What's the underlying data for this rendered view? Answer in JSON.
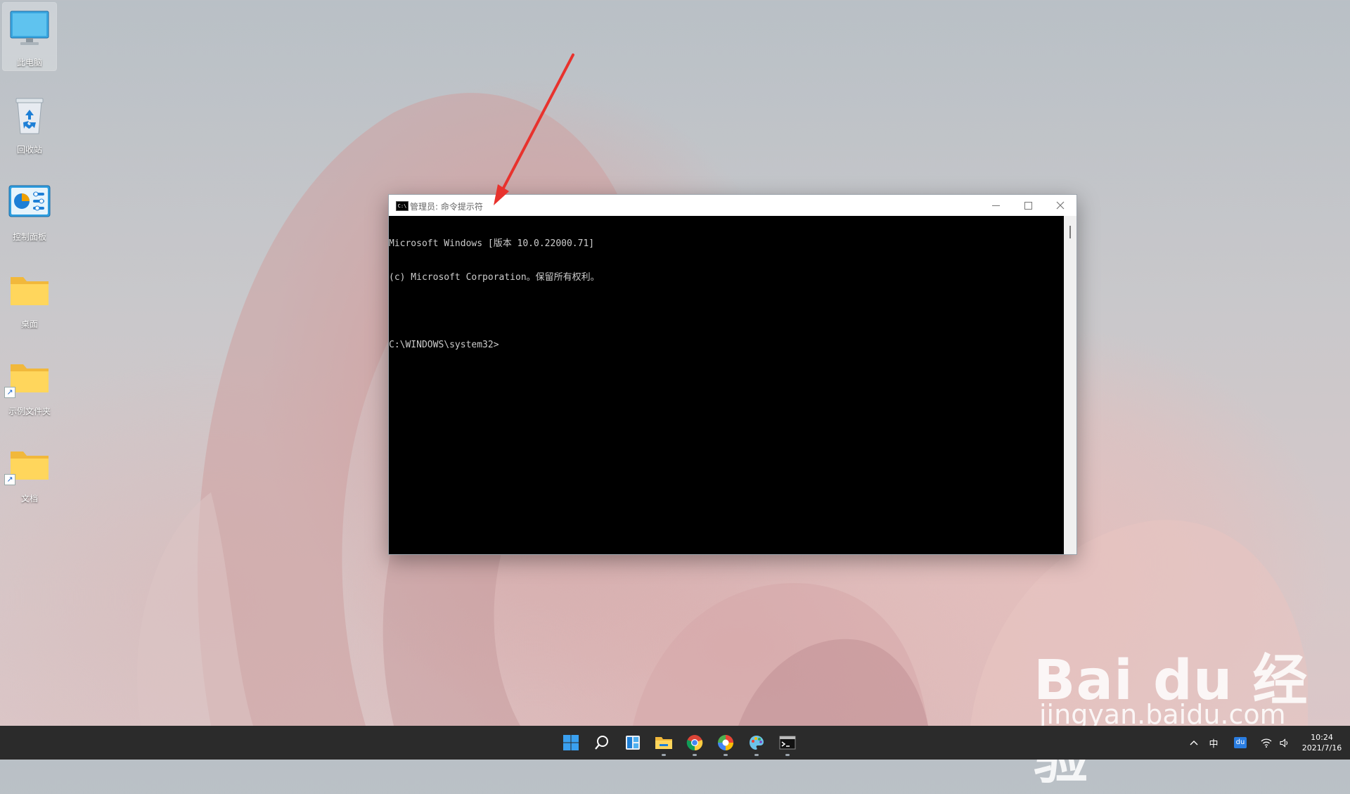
{
  "desktop": {
    "icons": [
      {
        "label": "此电脑"
      },
      {
        "label": "回收站"
      },
      {
        "label": "控制面板"
      },
      {
        "label": "桌面"
      },
      {
        "label": "示例文件夹"
      },
      {
        "label": "文档"
      }
    ]
  },
  "cmd_window": {
    "title": "管理员: 命令提示符",
    "icon_text": "C:\\",
    "lines": [
      "Microsoft Windows [版本 10.0.22000.71]",
      "(c) Microsoft Corporation。保留所有权利。",
      "",
      "C:\\WINDOWS\\system32>"
    ]
  },
  "taskbar": {
    "icons": [
      "windows-start-icon",
      "search-icon",
      "widgets-icon",
      "file-explorer-icon",
      "chrome-icon",
      "color-browser-icon",
      "paint-icon",
      "terminal-icon"
    ],
    "tray": {
      "ime": "中",
      "baidu": "du"
    },
    "clock": {
      "time": "10:24",
      "date": "2021/7/16"
    }
  },
  "watermark": {
    "logo": "Bai du 经验",
    "url": "jingyan.baidu.com"
  },
  "colors": {
    "annotation_arrow": "#e8322d",
    "taskbar": "#2b2b2b",
    "console_bg": "#000000",
    "console_text": "#cccccc"
  }
}
